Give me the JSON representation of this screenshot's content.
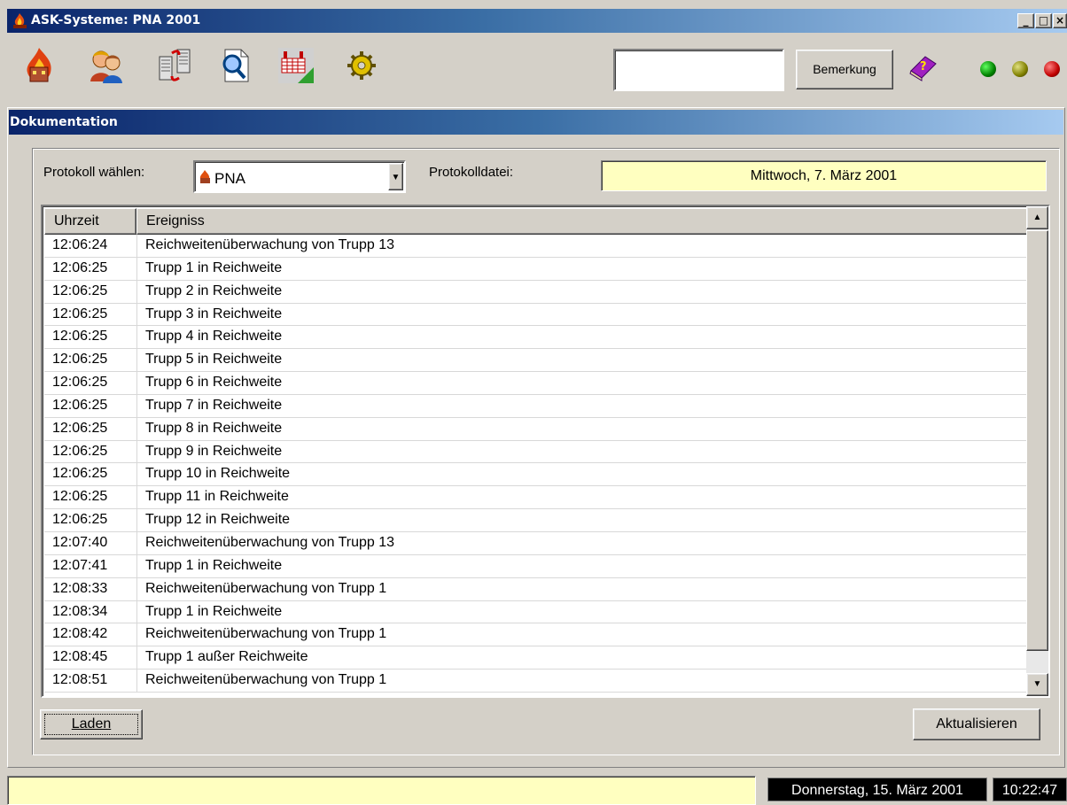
{
  "window": {
    "title": "ASK-Systeme: PNA 2001"
  },
  "caption_buttons": [
    "_",
    "□",
    "×"
  ],
  "toolbar": {
    "icons": [
      "fire-icon",
      "people-icon",
      "transfer-icon",
      "document-search-icon",
      "building-map-icon",
      "gear-icon"
    ],
    "remark_value": "",
    "remark_button": "Bemerkung",
    "help_icon": "help-book-icon",
    "lamps": {
      "green": "#008000",
      "yellow": "#808000",
      "red": "#c00000"
    }
  },
  "panel": {
    "title": "Dokumentation"
  },
  "protocol": {
    "select_label": "Protokoll wählen:",
    "select_value": "PNA",
    "file_label": "Protokolldatei:",
    "file_value": "Mittwoch, 7. März 2001"
  },
  "log": {
    "columns": [
      "Uhrzeit",
      "Ereigniss"
    ],
    "rows": [
      [
        "12:06:24",
        "Reichweitenüberwachung von Trupp 13"
      ],
      [
        "12:06:25",
        "Trupp 1 in Reichweite"
      ],
      [
        "12:06:25",
        "Trupp 2 in Reichweite"
      ],
      [
        "12:06:25",
        "Trupp 3 in Reichweite"
      ],
      [
        "12:06:25",
        "Trupp 4 in Reichweite"
      ],
      [
        "12:06:25",
        "Trupp 5 in Reichweite"
      ],
      [
        "12:06:25",
        "Trupp 6 in Reichweite"
      ],
      [
        "12:06:25",
        "Trupp 7 in Reichweite"
      ],
      [
        "12:06:25",
        "Trupp 8 in Reichweite"
      ],
      [
        "12:06:25",
        "Trupp 9 in Reichweite"
      ],
      [
        "12:06:25",
        "Trupp 10 in Reichweite"
      ],
      [
        "12:06:25",
        "Trupp 11 in Reichweite"
      ],
      [
        "12:06:25",
        "Trupp 12 in Reichweite"
      ],
      [
        "12:07:40",
        "Reichweitenüberwachung von Trupp 13"
      ],
      [
        "12:07:41",
        "Trupp 1 in Reichweite"
      ],
      [
        "12:08:33",
        "Reichweitenüberwachung von Trupp 1"
      ],
      [
        "12:08:34",
        "Trupp 1 in Reichweite"
      ],
      [
        "12:08:42",
        "Reichweitenüberwachung von Trupp 1"
      ],
      [
        "12:08:45",
        "Trupp 1 außer Reichweite"
      ],
      [
        "12:08:51",
        "Reichweitenüberwachung von Trupp 1"
      ]
    ]
  },
  "buttons": {
    "load": "Laden",
    "refresh": "Aktualisieren"
  },
  "statusbar": {
    "message": "",
    "date": "Donnerstag, 15. März 2001",
    "time": "10:22:47"
  }
}
